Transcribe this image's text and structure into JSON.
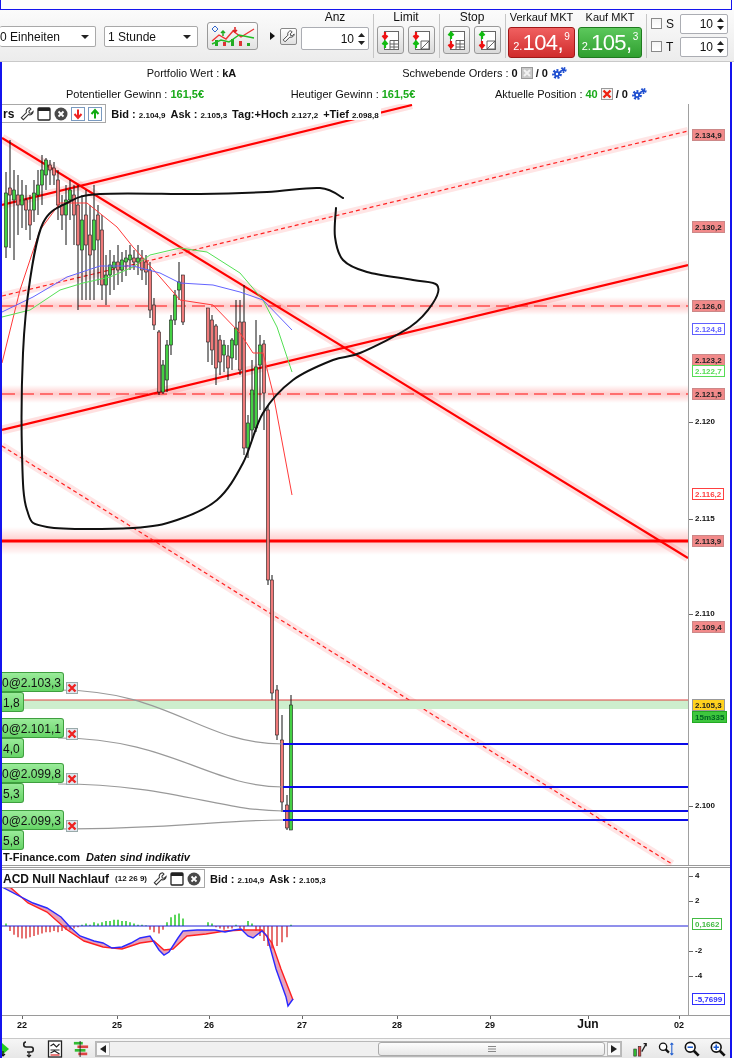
{
  "toolbar": {
    "units": {
      "value": "0 Einheiten"
    },
    "interval": {
      "value": "1 Stunde"
    },
    "quantity": {
      "label": "Anz",
      "value": "10"
    },
    "limit": {
      "label": "Limit"
    },
    "stop": {
      "label": "Stop"
    },
    "sell": {
      "label": "Verkauf MKT",
      "prefix": "2.",
      "main": "104,",
      "pip": "9"
    },
    "buy": {
      "label": "Kauf MKT",
      "prefix": "2.",
      "main": "105,",
      "pip": "3"
    },
    "options": [
      {
        "label": "S",
        "checked": false,
        "value": "10"
      },
      {
        "label": "T",
        "checked": false,
        "value": "10"
      }
    ]
  },
  "account": {
    "portfolio": {
      "label": "Portfolio Wert :",
      "value": "kA"
    },
    "pending_orders": {
      "label": "Schwebende Orders :",
      "value": "0",
      "rest": "/ 0"
    },
    "potential_profit": {
      "label": "Potentieller Gewinn :",
      "value": "161,5€"
    },
    "todays_profit": {
      "label": "Heutiger Gewinn :",
      "value": "161,5€"
    },
    "position": {
      "label": "Aktuelle Position :",
      "value": "40",
      "rest": "/ 0"
    }
  },
  "chart": {
    "title": "rs",
    "quotes": [
      {
        "label": "Bid :",
        "value": "2.104,9"
      },
      {
        "label": "Ask :",
        "value": "2.105,3"
      },
      {
        "label": "Tag:+Hoch",
        "value": "2.127,2"
      },
      {
        "label": "+Tief",
        "value": "2.098,8"
      }
    ],
    "price_axis": [
      {
        "text": "2.134,9",
        "kind": "line-tag"
      },
      {
        "text": "2.130,2",
        "kind": "line-tag"
      },
      {
        "text": "2.126,0",
        "kind": "line-tag"
      },
      {
        "text": "2.124,8",
        "kind": "indicator-tag",
        "color": "#6060ff"
      },
      {
        "text": "2.123,2",
        "kind": "line-tag"
      },
      {
        "text": "2.122,7",
        "kind": "indicator-tag",
        "color": "#55dd55"
      },
      {
        "text": "2.121,5",
        "kind": "line-tag"
      },
      {
        "text": "2.120",
        "kind": "tick"
      },
      {
        "text": "2.116,2",
        "kind": "indicator-tag",
        "color": "#ff4040"
      },
      {
        "text": "2.115",
        "kind": "tick"
      },
      {
        "text": "2.113,9",
        "kind": "line-tag"
      },
      {
        "text": "2.110",
        "kind": "tick"
      },
      {
        "text": "2.109,4",
        "kind": "line-tag"
      },
      {
        "text": "2.105,3",
        "kind": "bid-tag"
      },
      {
        "text": "15m335",
        "kind": "timer-tag"
      },
      {
        "text": "2.100",
        "kind": "tick"
      }
    ],
    "orders": [
      {
        "label": "0@2.103,3",
        "value": "1,8"
      },
      {
        "label": "0@2.101,1",
        "value": "4,0"
      },
      {
        "label": "0@2.099,8",
        "value": "5,3"
      },
      {
        "label": "0@2.099,3",
        "value": "5,8"
      }
    ],
    "source": "T-Finance.com",
    "note": "Daten sind indikativ"
  },
  "macd": {
    "title": "ACD Null Nachlauf",
    "params": "(12 26 9)",
    "quotes": [
      {
        "label": "Bid :",
        "value": "2.104,9"
      },
      {
        "label": "Ask :",
        "value": "2.105,3"
      }
    ],
    "axis": [
      {
        "text": "4",
        "kind": "tick"
      },
      {
        "text": "2",
        "kind": "tick"
      },
      {
        "text": "0,1662",
        "kind": "indicator-tag",
        "color": "#44bb44"
      },
      {
        "text": "-2",
        "kind": "tick"
      },
      {
        "text": "-4",
        "kind": "tick"
      },
      {
        "text": "-5,7699",
        "kind": "indicator-tag",
        "color": "#3030ff"
      }
    ]
  },
  "x_axis": [
    {
      "text": "22",
      "kind": "day"
    },
    {
      "text": "25",
      "kind": "day"
    },
    {
      "text": "26",
      "kind": "day"
    },
    {
      "text": "27",
      "kind": "day"
    },
    {
      "text": "28",
      "kind": "day"
    },
    {
      "text": "29",
      "kind": "day"
    },
    {
      "text": "Jun",
      "kind": "month"
    },
    {
      "text": "02",
      "kind": "day"
    }
  ]
}
